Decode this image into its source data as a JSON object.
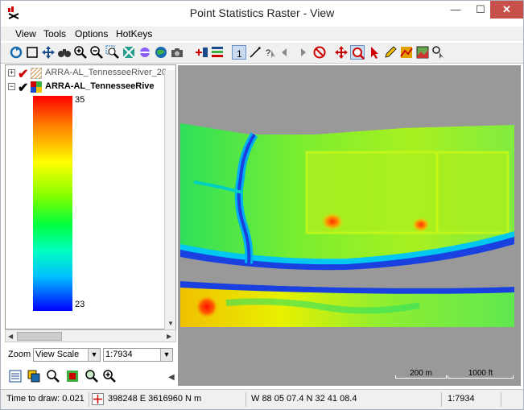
{
  "window": {
    "title": "Point Statistics Raster - View",
    "minimize_glyph": "—",
    "maximize_glyph": "☐",
    "close_glyph": "✕"
  },
  "menu": {
    "items": [
      "View",
      "Tools",
      "Options",
      "HotKeys"
    ]
  },
  "layers": [
    {
      "label": "ARRA-AL_TennesseeRiver_20",
      "checked": true,
      "bold": false,
      "icon": "raster-pattern-icon"
    },
    {
      "label": "ARRA-AL_TennesseeRive",
      "checked": true,
      "bold": true,
      "icon": "raster-color-icon"
    }
  ],
  "legend": {
    "max": "35",
    "min": "23"
  },
  "zoom": {
    "label": "Zoom",
    "mode": "View Scale",
    "scale": "1:7934"
  },
  "map": {
    "scalebar_meters": "200 m",
    "scalebar_feet": "1000 ft"
  },
  "status": {
    "time_to_draw": "Time to draw: 0.021",
    "easting_northing": "398248 E  3616960 N m",
    "lon_lat": "W 88 05 07.4  N 32 41 08.4",
    "scale": "1:7934"
  },
  "colors": {
    "background_gray": "#999999",
    "close_red": "#c7504b",
    "checkmark_red": "#cc0000"
  }
}
